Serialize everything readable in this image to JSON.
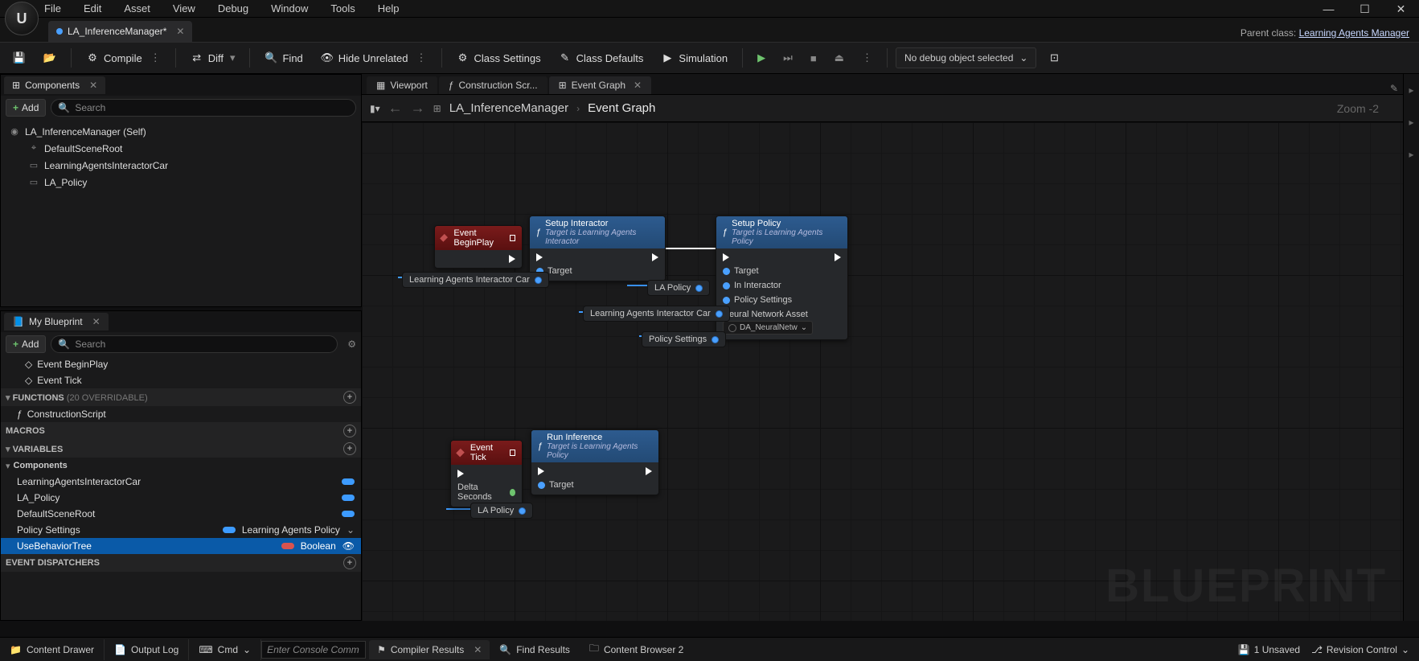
{
  "menu": [
    "File",
    "Edit",
    "Asset",
    "View",
    "Debug",
    "Window",
    "Tools",
    "Help"
  ],
  "doc_tab": {
    "title": "LA_InferenceManager*"
  },
  "parent": {
    "label": "Parent class:",
    "value": "Learning Agents Manager"
  },
  "toolbar": {
    "compile": "Compile",
    "diff": "Diff",
    "find": "Find",
    "hide": "Hide Unrelated",
    "class_settings": "Class Settings",
    "class_defaults": "Class Defaults",
    "simulation": "Simulation",
    "debug_sel": "No debug object selected"
  },
  "components_panel": {
    "title": "Components",
    "add": "Add",
    "search": "Search",
    "root": "LA_InferenceManager (Self)",
    "items": [
      "DefaultSceneRoot",
      "LearningAgentsInteractorCar",
      "LA_Policy"
    ]
  },
  "myblueprint": {
    "title": "My Blueprint",
    "add": "Add",
    "search": "Search",
    "events": [
      "Event BeginPlay",
      "Event Tick"
    ],
    "functions_hdr": "FUNCTIONS",
    "functions_note": "(20 OVERRIDABLE)",
    "functions": [
      "ConstructionScript"
    ],
    "macros_hdr": "MACROS",
    "variables_hdr": "VARIABLES",
    "components_hdr": "Components",
    "component_vars": [
      "LearningAgentsInteractorCar",
      "LA_Policy",
      "DefaultSceneRoot"
    ],
    "policy_settings": {
      "name": "Policy Settings",
      "type": "Learning Agents Policy"
    },
    "usebt": {
      "name": "UseBehaviorTree",
      "type": "Boolean"
    },
    "dispatch_hdr": "EVENT DISPATCHERS"
  },
  "center": {
    "tabs": {
      "viewport": "Viewport",
      "construction": "Construction Scr...",
      "event": "Event Graph"
    },
    "crumb1": "LA_InferenceManager",
    "crumb2": "Event Graph",
    "zoom": "Zoom -2"
  },
  "nodes": {
    "beginplay": "Event BeginPlay",
    "setup_interactor": {
      "title": "Setup Interactor",
      "sub": "Target is Learning Agents Interactor",
      "target": "Target"
    },
    "setup_policy": {
      "title": "Setup Policy",
      "sub": "Target is Learning Agents Policy",
      "target": "Target",
      "interactor": "In Interactor",
      "settings": "Policy Settings",
      "nna": "Neural Network Asset",
      "nna_val": "DA_NeuralNetw"
    },
    "tick": "Event Tick",
    "tick_delta": "Delta Seconds",
    "run_inference": {
      "title": "Run Inference",
      "sub": "Target is Learning Agents Policy",
      "target": "Target"
    },
    "var_interactor": "Learning Agents Interactor Car",
    "var_policy": "LA Policy",
    "var_interactor2": "Learning Agents Interactor Car",
    "var_psettings": "Policy Settings",
    "var_policy2": "LA Policy"
  },
  "bottom": {
    "content_drawer": "Content Drawer",
    "output_log": "Output Log",
    "cmd": "Cmd",
    "cmd_ph": "Enter Console Comm",
    "compiler": "Compiler Results",
    "find": "Find Results",
    "browser": "Content Browser 2",
    "unsaved": "1 Unsaved",
    "revision": "Revision Control"
  },
  "watermark": "BLUEPRINT"
}
